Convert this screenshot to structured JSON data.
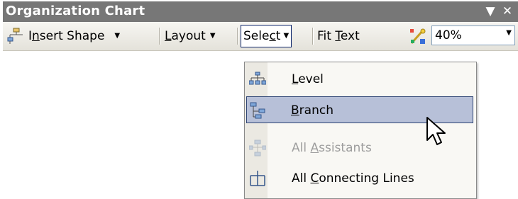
{
  "window": {
    "title": "Organization Chart",
    "minimize_glyph": "▼",
    "close_glyph": "✕"
  },
  "toolbar": {
    "insert_shape": {
      "label_pre": "I",
      "label_mnemonic": "n",
      "label_post": "sert Shape",
      "icon": "insert-shape-icon"
    },
    "layout": {
      "label_pre": "",
      "label_mnemonic": "L",
      "label_post": "ayout"
    },
    "select": {
      "label_pre": "Sele",
      "label_mnemonic": "c",
      "label_post": "t"
    },
    "fit_text": {
      "label_pre": "Fit ",
      "label_mnemonic": "T",
      "label_post": "ext"
    },
    "autoformat": {
      "icon": "autoformat-icon"
    },
    "zoom": {
      "value": "40%"
    }
  },
  "select_menu": {
    "items": [
      {
        "label_pre": "",
        "label_mnemonic": "L",
        "label_post": "evel",
        "icon": "level-icon",
        "state": "normal"
      },
      {
        "label_pre": "",
        "label_mnemonic": "B",
        "label_post": "ranch",
        "icon": "branch-icon",
        "state": "highlighted"
      },
      {
        "label_pre": "All ",
        "label_mnemonic": "A",
        "label_post": "ssistants",
        "icon": "assistants-icon",
        "state": "disabled"
      },
      {
        "label_pre": "All ",
        "label_mnemonic": "C",
        "label_post": "onnecting Lines",
        "icon": "connecting-lines-icon",
        "state": "normal"
      }
    ]
  },
  "colors": {
    "title_bar": "#777777",
    "menu_highlight": "#b7c0d8",
    "menu_highlight_border": "#2e4474",
    "disabled_text": "#9e9e9e"
  }
}
